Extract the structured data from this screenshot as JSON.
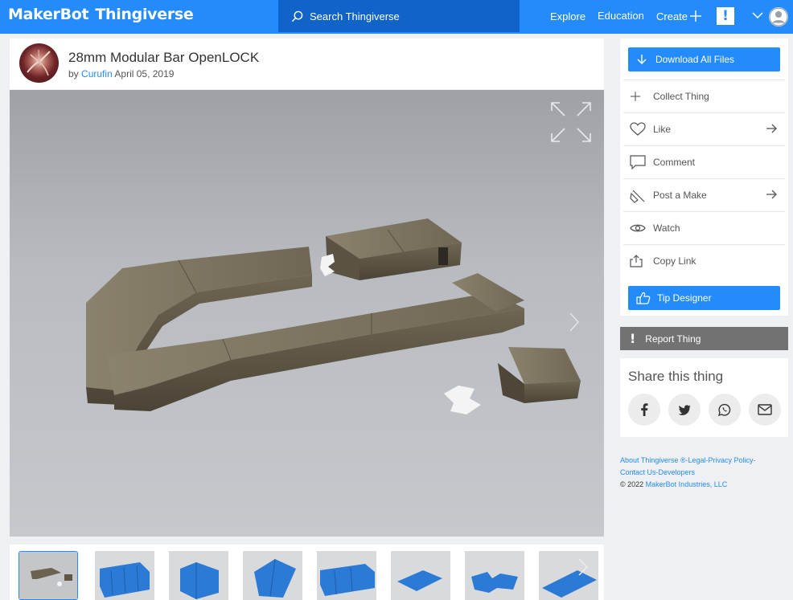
{
  "topbar": {
    "logo_makerbot": "MakerBot",
    "logo_thingiverse": "Thingiverse",
    "search_placeholder": "Search Thingiverse",
    "nav": {
      "explore": "Explore",
      "education": "Education",
      "create": "Create"
    },
    "alert_label": "!"
  },
  "thing": {
    "title": "28mm Modular Bar OpenLOCK",
    "by_prefix": "by",
    "author": "Curufin",
    "date": "April 05, 2019",
    "thumbnail_count": 8,
    "active_thumbnail": 1
  },
  "actions": {
    "download": "Download All Files",
    "collect": "Collect Thing",
    "like": "Like",
    "comment": "Comment",
    "post_make": "Post a Make",
    "watch": "Watch",
    "copy_link": "Copy Link",
    "tip": "Tip Designer",
    "report": "Report Thing",
    "report_mark": "!"
  },
  "share": {
    "title": "Share this thing",
    "networks": [
      "facebook-icon",
      "twitter-icon",
      "whatsapp-icon",
      "email-icon"
    ]
  },
  "footer": {
    "about": "About Thingiverse ®",
    "legal": "Legal",
    "privacy": "Privacy Policy",
    "contact": "Contact Us",
    "developers": "Developers",
    "copyright": "©  2022",
    "company": "MakerBot Industries, LLC"
  },
  "colors": {
    "brand_blue": "#248bfb",
    "search_blue": "#0f63c9",
    "report_gray": "#727272",
    "page_bg": "#eef0f3"
  }
}
